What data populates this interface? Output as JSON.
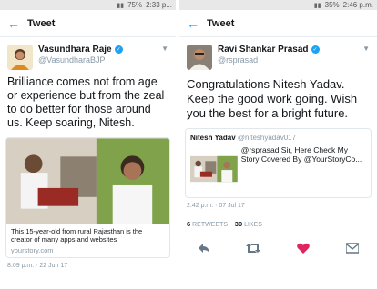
{
  "left": {
    "status": {
      "battery": "75%",
      "time": "2:33 p..."
    },
    "appbar": {
      "title": "Tweet"
    },
    "author": {
      "name": "Vasundhara Raje",
      "handle": "@VasundharaBJP"
    },
    "text": "Brilliance comes not from age or experience but from the zeal to do better for those around us. Keep soaring, Nitesh.",
    "card": {
      "description": "This 15-year-old from rural Rajasthan is the creator of many apps and websites",
      "url": "yourstory.com"
    },
    "meta": "8:09 p.m. · 22 Jun 17"
  },
  "right": {
    "status": {
      "battery": "35%",
      "time": "2:46 p.m."
    },
    "appbar": {
      "title": "Tweet"
    },
    "author": {
      "name": "Ravi Shankar Prasad",
      "handle": "@rsprasad"
    },
    "text": "Congratulations Nitesh Yadav. Keep the good work going. Wish you the best for a bright future.",
    "quote": {
      "name": "Nitesh Yadav",
      "handle": "@niteshyadav017",
      "text": "@rsprasad Sir, Here Check My Story Covered By @YourStoryCo..."
    },
    "meta": "2:42 p.m. · 07 Jul 17",
    "stats": {
      "retweets_count": "6",
      "retweets_label": "RETWEETS",
      "likes_count": "39",
      "likes_label": "LIKES"
    }
  },
  "colors": {
    "accent": "#1da1f2",
    "like": "#e0245e",
    "muted": "#8899a6"
  },
  "icons": [
    "back-arrow-icon",
    "verified-icon",
    "chevron-down-icon",
    "reply-icon",
    "retweet-icon",
    "like-icon",
    "share-icon"
  ]
}
